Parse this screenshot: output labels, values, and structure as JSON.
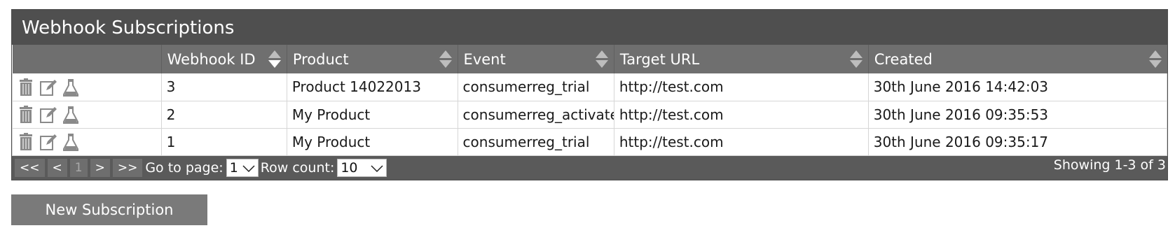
{
  "panel": {
    "title": "Webhook Subscriptions"
  },
  "table": {
    "columns": [
      {
        "label": ""
      },
      {
        "label": "Webhook ID"
      },
      {
        "label": "Product"
      },
      {
        "label": "Event"
      },
      {
        "label": "Target URL"
      },
      {
        "label": "Created"
      }
    ],
    "rows": [
      {
        "id": "3",
        "product": "Product 14022013",
        "event": "consumerreg_trial",
        "url": "http://test.com",
        "created": "30th June 2016 14:42:03"
      },
      {
        "id": "2",
        "product": "My Product",
        "event": "consumerreg_activated",
        "url": "http://test.com",
        "created": "30th June 2016 09:35:53"
      },
      {
        "id": "1",
        "product": "My Product",
        "event": "consumerreg_trial",
        "url": "http://test.com",
        "created": "30th June 2016 09:35:17"
      }
    ],
    "row_icons": [
      "trash-icon",
      "edit-icon",
      "flask-icon"
    ]
  },
  "pager": {
    "first": "<<",
    "prev": "<",
    "current": "1",
    "next": ">",
    "last": ">>",
    "goto_label": "Go to page:",
    "goto_value": "1",
    "rowcount_label": "Row count:",
    "rowcount_value": "10",
    "showing": "Showing 1-3 of 3"
  },
  "new_button": "New Subscription",
  "colors": {
    "title_bg": "#4f4f4f",
    "header_bg": "#6f6f6f",
    "pager_bg": "#5a5a5a",
    "button_bg": "#7a7a7a",
    "icon": "#8a8a8a"
  }
}
